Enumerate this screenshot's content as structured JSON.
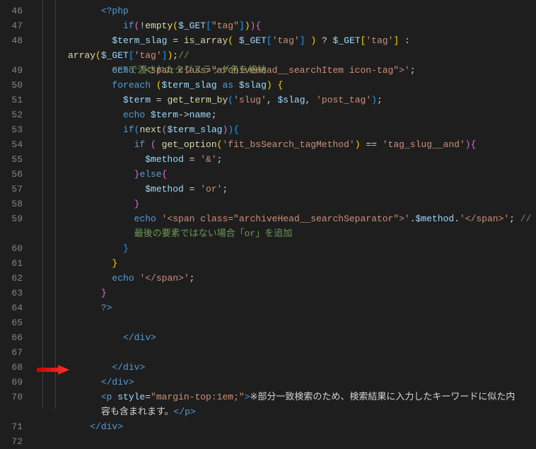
{
  "lines": [
    {
      "n": "46",
      "ind": "      ",
      "tokens": [
        [
          "phpd",
          "<?php"
        ]
      ]
    },
    {
      "n": "47",
      "ind": "          ",
      "tokens": [
        [
          "kw",
          "if"
        ],
        [
          "pbr",
          "("
        ],
        [
          "op",
          "!"
        ],
        [
          "fn",
          "empty"
        ],
        [
          "ybr",
          "("
        ],
        [
          "var",
          "$_GET"
        ],
        [
          "bbr",
          "["
        ],
        [
          "str",
          "\"tag\""
        ],
        [
          "bbr",
          "]"
        ],
        [
          "ybr",
          ")"
        ],
        [
          "pbr",
          ")"
        ],
        [
          "pbr",
          "{"
        ]
      ]
    },
    {
      "n": "48",
      "ind": "        ",
      "tall": true,
      "tokens": [
        [
          "var",
          "$term_slag"
        ],
        [
          "op",
          " = "
        ],
        [
          "fn",
          "is_array"
        ],
        [
          "ybr",
          "( "
        ],
        [
          "var",
          "$_GET"
        ],
        [
          "bbr",
          "["
        ],
        [
          "str",
          "'tag'"
        ],
        [
          "bbr",
          "]"
        ],
        [
          "ybr",
          " )"
        ],
        [
          "op",
          " ? "
        ],
        [
          "var",
          "$_GET"
        ],
        [
          "ybr",
          "["
        ],
        [
          "str",
          "'tag'"
        ],
        [
          "ybr",
          "]"
        ],
        [
          "op",
          " : "
        ],
        [
          "fn",
          "array"
        ],
        [
          "ybr",
          "("
        ],
        [
          "var",
          "$_GET"
        ],
        [
          "bbr",
          "["
        ],
        [
          "str",
          "'tag'"
        ],
        [
          "bbr",
          "]"
        ],
        [
          "ybr",
          ")"
        ],
        [
          "op",
          ";"
        ],
        [
          "cmt",
          "//\n        GETで渡されたタグスラッグ名を格納"
        ]
      ]
    },
    {
      "n": "49",
      "ind": "        ",
      "tokens": [
        [
          "kw",
          "echo "
        ],
        [
          "str",
          "'<span class=\"archiveHead__searchItem icon-tag\">'"
        ],
        [
          "op",
          ";"
        ]
      ]
    },
    {
      "n": "50",
      "ind": "        ",
      "tokens": [
        [
          "kw",
          "foreach "
        ],
        [
          "ybr",
          "("
        ],
        [
          "var",
          "$term_slag"
        ],
        [
          "kw",
          " as "
        ],
        [
          "var",
          "$slag"
        ],
        [
          "ybr",
          ")"
        ],
        [
          "ybr",
          " {"
        ]
      ]
    },
    {
      "n": "51",
      "ind": "          ",
      "tokens": [
        [
          "var",
          "$term"
        ],
        [
          "op",
          " = "
        ],
        [
          "fn",
          "get_term_by"
        ],
        [
          "bbr",
          "("
        ],
        [
          "str",
          "'slug'"
        ],
        [
          "op",
          ", "
        ],
        [
          "var",
          "$slag"
        ],
        [
          "op",
          ", "
        ],
        [
          "str",
          "'post_tag'"
        ],
        [
          "bbr",
          ")"
        ],
        [
          "op",
          ";"
        ]
      ]
    },
    {
      "n": "52",
      "ind": "          ",
      "tokens": [
        [
          "kw",
          "echo "
        ],
        [
          "var",
          "$term"
        ],
        [
          "op",
          "->"
        ],
        [
          "var",
          "name"
        ],
        [
          "op",
          ";"
        ]
      ]
    },
    {
      "n": "53",
      "ind": "          ",
      "tokens": [
        [
          "kw",
          "if"
        ],
        [
          "bbr",
          "("
        ],
        [
          "fn",
          "next"
        ],
        [
          "pbr",
          "("
        ],
        [
          "var",
          "$term_slag"
        ],
        [
          "pbr",
          ")"
        ],
        [
          "bbr",
          ")"
        ],
        [
          "bbr",
          "{"
        ]
      ]
    },
    {
      "n": "54",
      "ind": "            ",
      "tokens": [
        [
          "kw",
          "if "
        ],
        [
          "pbr",
          "( "
        ],
        [
          "fn",
          "get_option"
        ],
        [
          "ybr",
          "("
        ],
        [
          "str",
          "'fit_bsSearch_tagMethod'"
        ],
        [
          "ybr",
          ")"
        ],
        [
          "op",
          " == "
        ],
        [
          "str",
          "'tag_slug__and'"
        ],
        [
          "pbr",
          ")"
        ],
        [
          "pbr",
          "{"
        ]
      ]
    },
    {
      "n": "55",
      "ind": "              ",
      "tokens": [
        [
          "var",
          "$method"
        ],
        [
          "op",
          " = "
        ],
        [
          "str",
          "'&'"
        ],
        [
          "op",
          ";"
        ]
      ]
    },
    {
      "n": "56",
      "ind": "            ",
      "tokens": [
        [
          "pbr",
          "}"
        ],
        [
          "kw",
          "else"
        ],
        [
          "pbr",
          "{"
        ]
      ]
    },
    {
      "n": "57",
      "ind": "              ",
      "tokens": [
        [
          "var",
          "$method"
        ],
        [
          "op",
          " = "
        ],
        [
          "str",
          "'or'"
        ],
        [
          "op",
          ";"
        ]
      ]
    },
    {
      "n": "58",
      "ind": "            ",
      "tokens": [
        [
          "pbr",
          "}"
        ]
      ]
    },
    {
      "n": "59",
      "ind": "            ",
      "tall": true,
      "tokens": [
        [
          "kw",
          "echo "
        ],
        [
          "str",
          "'<span class=\"archiveHead__searchSeparator\">'"
        ],
        [
          "op",
          "."
        ],
        [
          "var",
          "$method"
        ],
        [
          "op",
          "."
        ],
        [
          "str",
          "'</span>'"
        ],
        [
          "op",
          "; "
        ],
        [
          "cmt",
          "//\n            最後の要素ではない場合「or」を追加"
        ]
      ]
    },
    {
      "n": "60",
      "ind": "          ",
      "tokens": [
        [
          "bbr",
          "}"
        ]
      ]
    },
    {
      "n": "61",
      "ind": "        ",
      "tokens": [
        [
          "ybr",
          "}"
        ]
      ]
    },
    {
      "n": "62",
      "ind": "        ",
      "tokens": [
        [
          "kw",
          "echo "
        ],
        [
          "str",
          "'</span>'"
        ],
        [
          "op",
          ";"
        ]
      ]
    },
    {
      "n": "63",
      "ind": "      ",
      "tokens": [
        [
          "pbr",
          "}"
        ]
      ]
    },
    {
      "n": "64",
      "ind": "      ",
      "tokens": [
        [
          "phpd",
          "?>"
        ]
      ]
    },
    {
      "n": "65",
      "ind": "",
      "tokens": []
    },
    {
      "n": "66",
      "ind": "          ",
      "tokens": [
        [
          "tag",
          "</div>"
        ]
      ]
    },
    {
      "n": "67",
      "ind": "",
      "tokens": []
    },
    {
      "n": "68",
      "ind": "        ",
      "tokens": [
        [
          "tag",
          "</div>"
        ]
      ]
    },
    {
      "n": "69",
      "ind": "      ",
      "tokens": [
        [
          "tag",
          "</div>"
        ]
      ]
    },
    {
      "n": "70",
      "ind": "      ",
      "tall": true,
      "tokens": [
        [
          "tag",
          "<p "
        ],
        [
          "attr",
          "style"
        ],
        [
          "op",
          "="
        ],
        [
          "str",
          "\"margin-top:1em;\""
        ],
        [
          "tag",
          ">"
        ],
        [
          "txt",
          "※部分一致検索のため、検索結果に入力したキーワードに似た内\n      容も含まれます。"
        ],
        [
          "tag",
          "</p>"
        ]
      ]
    },
    {
      "n": "71",
      "ind": "    ",
      "tokens": [
        [
          "tag",
          "</div>"
        ]
      ]
    },
    {
      "n": "72",
      "ind": "",
      "tokens": []
    }
  ]
}
